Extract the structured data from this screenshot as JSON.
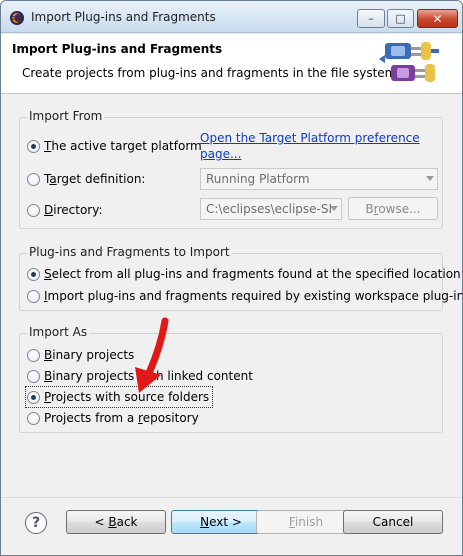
{
  "window": {
    "title": "Import Plug-ins and Fragments",
    "min_glyph": "–",
    "max_glyph": "□",
    "close_glyph": "✕"
  },
  "header": {
    "title": "Import Plug-ins and Fragments",
    "description": "Create projects from plug-ins and fragments in the file system."
  },
  "import_from": {
    "group_title": "Import From",
    "active_target": {
      "label_mn": "T",
      "label_rest": "he active target platform",
      "checked": true
    },
    "link_line1": "Open the Target Platform preference",
    "link_line2": "page...",
    "target_definition": {
      "label_pre": "T",
      "label_mn": "a",
      "label_rest": "rget definition:",
      "checked": false
    },
    "target_definition_value": "Running Platform",
    "directory": {
      "label_mn": "D",
      "label_rest": "irectory:",
      "checked": false
    },
    "directory_value": "C:\\eclipses\\eclipse-SI",
    "browse_pre": "B",
    "browse_mn": "r",
    "browse_rest": "owse..."
  },
  "plugins_to_import": {
    "group_title": "Plug-ins and Fragments to Import",
    "option1": {
      "label_mn": "S",
      "label_rest": "elect from all plug-ins and fragments found at the specified location",
      "checked": true
    },
    "option2": {
      "label_mn": "I",
      "label_rest": "mport plug-ins and fragments required by existing workspace plug-ins",
      "checked": false
    }
  },
  "import_as": {
    "group_title": "Import As",
    "binary": {
      "label_mn": "B",
      "label_rest": "inary projects",
      "checked": false
    },
    "binary_linked": {
      "label_mn": "B",
      "label_rest": "inary projects with linked content",
      "checked": false
    },
    "source_folders": {
      "label_mn": "P",
      "label_rest": "rojects with source folders",
      "checked": true
    },
    "repository": {
      "label_pre": "Projects from a ",
      "label_mn": "r",
      "label_rest": "epository",
      "checked": false
    }
  },
  "footer": {
    "help_glyph": "?",
    "back_pre": "< ",
    "back_mn": "B",
    "back_rest": "ack",
    "next_mn": "N",
    "next_rest": "ext >",
    "finish_mn": "F",
    "finish_rest": "inish",
    "cancel": "Cancel"
  },
  "annotation": {
    "arrow_color": "#e01818"
  }
}
